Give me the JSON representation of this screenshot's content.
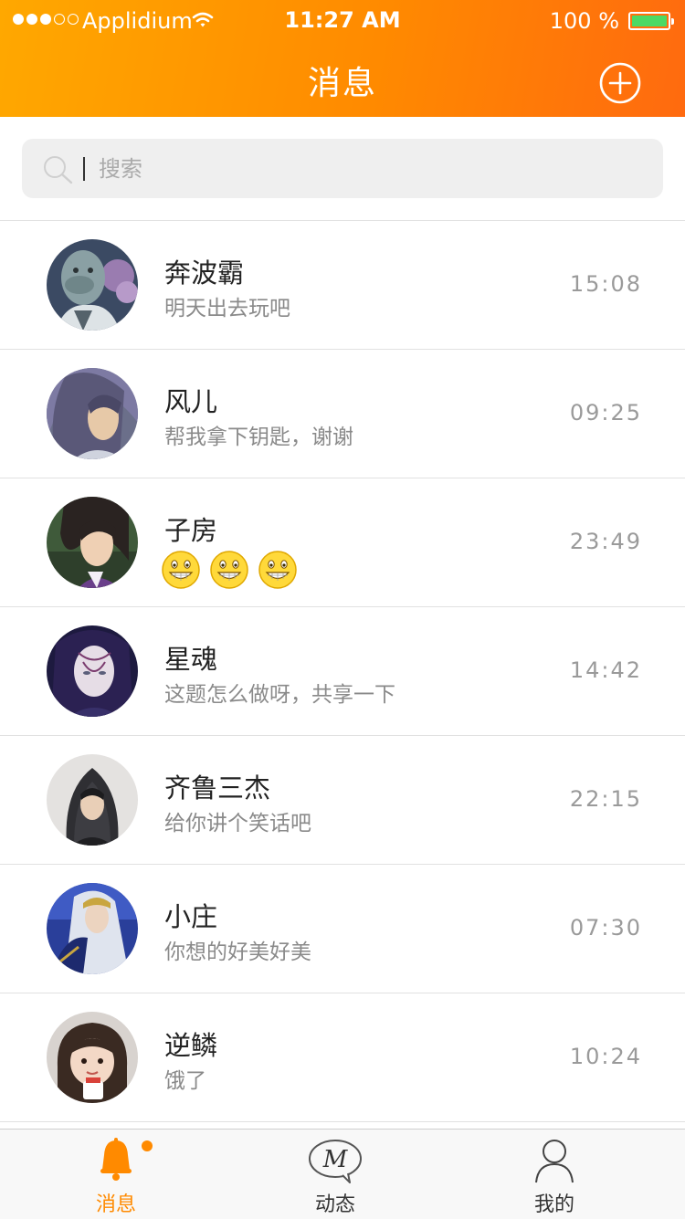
{
  "status_bar": {
    "carrier": "Applidium",
    "time": "11:27 AM",
    "battery": "100 %"
  },
  "nav": {
    "title": "消息"
  },
  "search": {
    "placeholder": "搜索",
    "value": ""
  },
  "chats": [
    {
      "name": "奔波霸",
      "preview": "明天出去玩吧",
      "time": "15:08"
    },
    {
      "name": "风儿",
      "preview": "帮我拿下钥匙，谢谢",
      "time": "09:25"
    },
    {
      "name": "子房",
      "preview": "",
      "preview_emoji": [
        "grin-emoji",
        "grin-emoji",
        "grin-emoji"
      ],
      "time": "23:49"
    },
    {
      "name": "星魂",
      "preview": "这题怎么做呀，共享一下",
      "time": "14:42"
    },
    {
      "name": "齐鲁三杰",
      "preview": "给你讲个笑话吧",
      "time": "22:15"
    },
    {
      "name": "小庄",
      "preview": "你想的好美好美",
      "time": "07:30"
    },
    {
      "name": "逆鳞",
      "preview": "饿了",
      "time": "10:24"
    }
  ],
  "tabs": [
    {
      "label": "消息",
      "icon": "bell-icon",
      "active": true,
      "badge": true
    },
    {
      "label": "动态",
      "icon": "moments-icon",
      "active": false
    },
    {
      "label": "我的",
      "icon": "person-icon",
      "active": false
    }
  ],
  "colors": {
    "accent": "#ff8a00",
    "header_start": "#ffa800",
    "header_end": "#ff6a0f",
    "battery_fill": "#4cd964"
  }
}
